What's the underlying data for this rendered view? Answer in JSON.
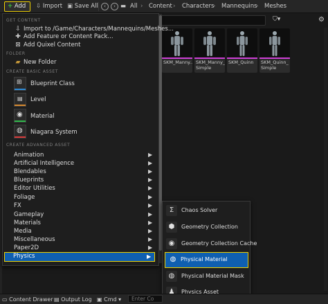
{
  "toolbar": {
    "add_label": "Add",
    "import_label": "Import",
    "save_all_label": "Save All",
    "breadcrumbs": [
      "All",
      "Content",
      "Characters",
      "Mannequins",
      "Meshes"
    ]
  },
  "assets": [
    {
      "name": "SKM_Manny",
      "visible_name": "SKM_Manny"
    },
    {
      "name": "SKM_Manny_Simple",
      "visible_name": "SKM_Manny_Simple"
    },
    {
      "name": "SKM_Quinn",
      "visible_name": "SKM_Quinn"
    },
    {
      "name": "SKM_Quinn_Simple",
      "visible_name": "SKM_Quinn_Simple"
    }
  ],
  "asset_labels": [
    "SKM_Manny...",
    "SKM_Manny_ Simple",
    "SKM_Quinn",
    "SKM_Quinn_ Simple"
  ],
  "menu": {
    "get_content_header": "GET CONTENT",
    "import_to": "Import to /Game/Characters/Mannequins/Meshes...",
    "add_feature": "Add Feature or Content Pack...",
    "add_quixel": "Add Quixel Content",
    "folder_header": "FOLDER",
    "new_folder": "New Folder",
    "basic_header": "CREATE BASIC ASSET",
    "basic_assets": [
      {
        "label": "Blueprint Class",
        "color": "#2f8cd8"
      },
      {
        "label": "Level",
        "color": "#d88a2f"
      },
      {
        "label": "Material",
        "color": "#2fb84a"
      },
      {
        "label": "Niagara System",
        "color": "#d83a3a"
      }
    ],
    "advanced_header": "CREATE ADVANCED ASSET",
    "advanced_items": [
      "Animation",
      "Artificial Intelligence",
      "Blendables",
      "Blueprints",
      "Editor Utilities",
      "Foliage",
      "FX",
      "Gameplay",
      "Materials",
      "Media",
      "Miscellaneous",
      "Paper2D",
      "Physics"
    ]
  },
  "submenu": {
    "items": [
      "Chaos Solver",
      "Geometry Collection",
      "Geometry Collection Cache",
      "Physical Material",
      "Physical Material Mask",
      "Physics Asset"
    ]
  },
  "statusbar": {
    "content_drawer": "Content Drawer",
    "output_log": "Output Log",
    "cmd": "Cmd",
    "console_placeholder": "Enter Co"
  },
  "colors": {
    "highlight": "#f0d200",
    "selection": "#0f5fb0",
    "asset_stripe": "#cf3fd6"
  }
}
